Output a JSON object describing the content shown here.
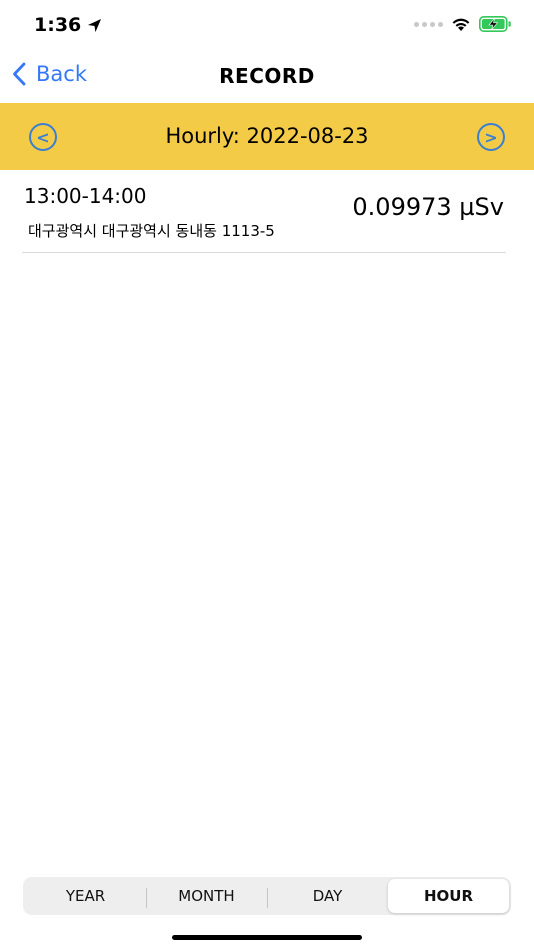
{
  "status_bar": {
    "time": "1:36",
    "icons": [
      "location-arrow-icon",
      "signal-dots-icon",
      "wifi-icon",
      "battery-charging-icon"
    ],
    "battery_color": "#34c759"
  },
  "nav": {
    "back_label": "Back",
    "title": "RECORD",
    "accent_color": "#3478f6"
  },
  "date_bar": {
    "title": "Hourly: 2022-08-23",
    "prev_label": "<",
    "next_label": ">",
    "background_color": "#f4cb47"
  },
  "records": [
    {
      "time_range": "13:00-14:00",
      "address": "대구광역시  대구광역시  동내동  1113-5",
      "value": "0.09973 µSv"
    }
  ],
  "segments": {
    "items": [
      "YEAR",
      "MONTH",
      "DAY",
      "HOUR"
    ],
    "selected": "HOUR"
  }
}
